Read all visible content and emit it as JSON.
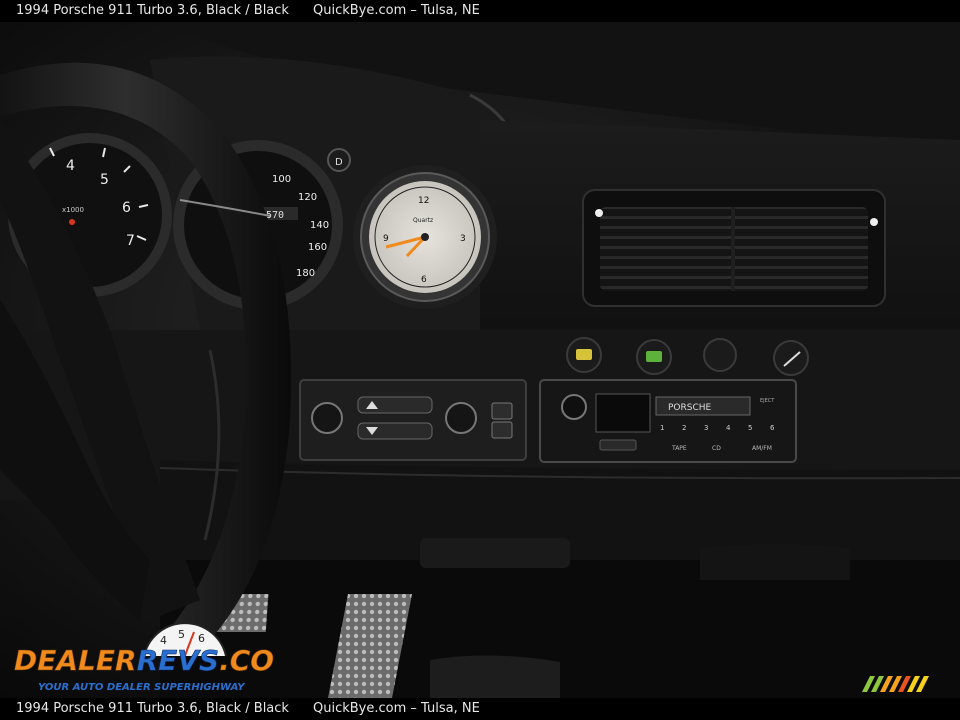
{
  "caption": {
    "title": "1994 Porsche 911 Turbo 3.6,  Black / Black",
    "site": "QuickBye.com – Tulsa, NE"
  },
  "photo": {
    "subject": "Porsche 911 interior dashboard",
    "tach_numerals": [
      "4",
      "5",
      "6",
      "7"
    ],
    "tach_unit": "x1000",
    "speed_numerals": [
      "100",
      "120",
      "140",
      "160",
      "180"
    ],
    "odometer": "570",
    "clock_brand": "Quartz",
    "clock_numerals": [
      "12",
      "3",
      "6",
      "9"
    ],
    "radio_brand": "PORSCHE",
    "radio_buttons": [
      "1",
      "2",
      "3",
      "4",
      "5",
      "6"
    ],
    "radio_labels": [
      "TAPE",
      "CD",
      "AM/FM",
      "EJECT"
    ]
  },
  "watermark": {
    "logo_text": "DealerRevs.com",
    "logo_word1": "DEALER",
    "logo_word2": "REVS",
    "logo_domain": ".COM",
    "tagline": "YOUR AUTO DEALER SUPERHIGHWAY",
    "gauge_digits": [
      "4",
      "5",
      "6"
    ]
  },
  "colors": {
    "accent_orange": "#f08a1c",
    "accent_blue": "#2a6fd0",
    "stripe_colors": [
      "#8ec63f",
      "#f6a21e",
      "#e8531f",
      "#f6d21e"
    ]
  }
}
